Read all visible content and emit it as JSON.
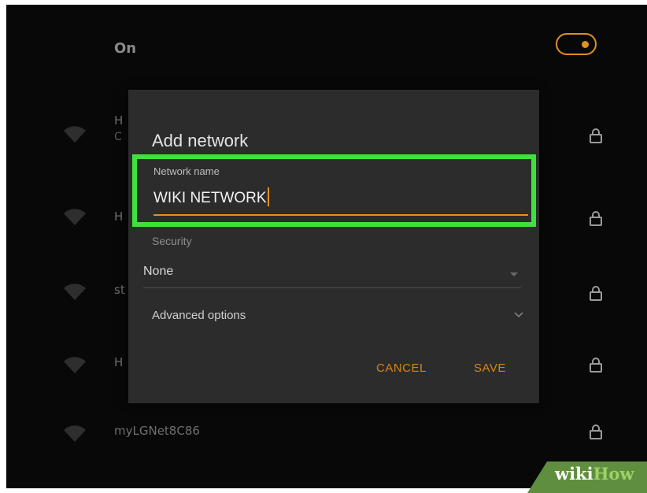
{
  "wifi": {
    "toggle_label": "On",
    "toggle_state": "on",
    "networks": [
      {
        "name": "H",
        "sub": "C",
        "locked": true,
        "partially_hidden": true
      },
      {
        "name": "H",
        "locked": true,
        "partially_hidden": true
      },
      {
        "name": "st",
        "locked": true,
        "partially_hidden": true
      },
      {
        "name": "H",
        "locked": true,
        "partially_hidden": true
      },
      {
        "name": "myLGNet8C86",
        "locked": true,
        "partially_hidden": false
      }
    ]
  },
  "dialog": {
    "title": "Add network",
    "network_name": {
      "label": "Network name",
      "value": "WIKI NETWORK"
    },
    "security": {
      "label": "Security",
      "selected": "None"
    },
    "advanced_label": "Advanced options",
    "cancel_label": "CANCEL",
    "save_label": "SAVE"
  },
  "watermark": {
    "part1": "wiki",
    "part2": "How"
  },
  "colors": {
    "accent": "#e0911f",
    "highlight": "#3ee23c",
    "background": "#080808",
    "dialog": "#2c2c2c"
  },
  "icons": {
    "wifi": "wifi-signal-icon",
    "lock": "lock-icon",
    "chevron": "chevron-down-icon",
    "dropdown": "dropdown-arrow-icon"
  }
}
